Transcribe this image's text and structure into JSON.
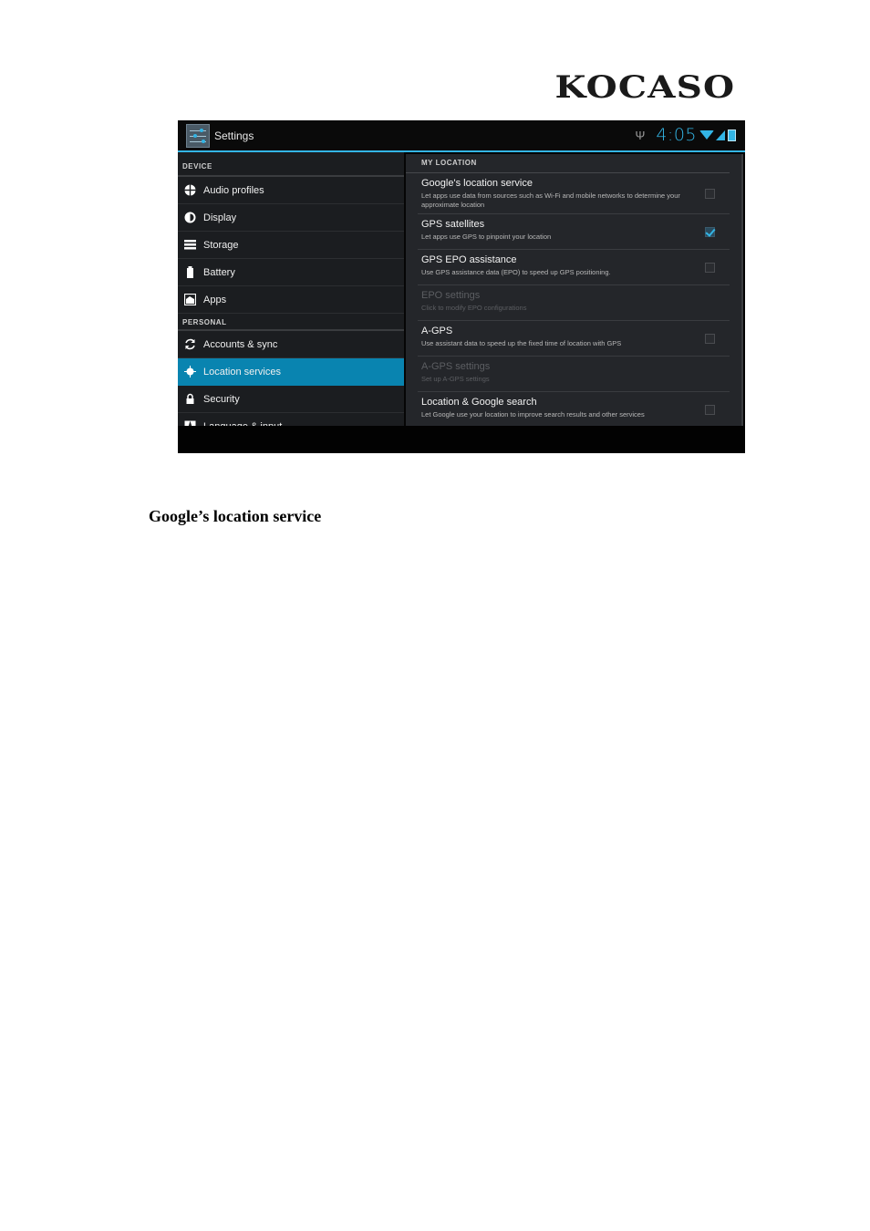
{
  "document": {
    "logo": "KOCASO",
    "caption": "Google’s location service"
  },
  "screenshot": {
    "action_bar": {
      "title": "Settings",
      "app_icon": "settings-sliders-icon"
    },
    "status_bar": {
      "usb_icon": "usb-icon",
      "time": "4:05",
      "wifi_icon": "wifi-icon",
      "signal_icon": "cell-signal-icon",
      "battery_icon": "battery-charging-icon",
      "accent_color": "#33b5e5"
    },
    "sidebar": {
      "sections": [
        {
          "header": "DEVICE",
          "items": [
            {
              "label": "Audio profiles",
              "icon": "audio-profiles-icon",
              "active": false
            },
            {
              "label": "Display",
              "icon": "display-brightness-icon",
              "active": false
            },
            {
              "label": "Storage",
              "icon": "storage-icon",
              "active": false
            },
            {
              "label": "Battery",
              "icon": "battery-icon",
              "active": false
            },
            {
              "label": "Apps",
              "icon": "apps-icon",
              "active": false
            }
          ]
        },
        {
          "header": "PERSONAL",
          "items": [
            {
              "label": "Accounts & sync",
              "icon": "sync-icon",
              "active": false
            },
            {
              "label": "Location services",
              "icon": "location-icon",
              "active": true
            },
            {
              "label": "Security",
              "icon": "lock-icon",
              "active": false
            },
            {
              "label": "Language & input",
              "icon": "language-icon",
              "active": false
            }
          ]
        }
      ],
      "active_color": "#0984b0"
    },
    "detail": {
      "header": "MY LOCATION",
      "prefs": [
        {
          "title": "Google's location service",
          "summary": "Let apps use data from sources such as Wi-Fi and mobile networks to determine your approximate location",
          "checkbox": true,
          "checked": false,
          "enabled": true
        },
        {
          "title": "GPS satellites",
          "summary": "Let apps use GPS to pinpoint your location",
          "checkbox": true,
          "checked": true,
          "enabled": true
        },
        {
          "title": "GPS EPO assistance",
          "summary": "Use GPS assistance data (EPO) to speed up GPS positioning.",
          "checkbox": true,
          "checked": false,
          "enabled": true
        },
        {
          "title": "EPO settings",
          "summary": "Click to modify EPO configurations",
          "checkbox": false,
          "checked": false,
          "enabled": false
        },
        {
          "title": "A-GPS",
          "summary": "Use assistant data to speed up the fixed time of location with GPS",
          "checkbox": true,
          "checked": false,
          "enabled": true
        },
        {
          "title": "A-GPS settings",
          "summary": "Set up A-GPS settings",
          "checkbox": false,
          "checked": false,
          "enabled": false
        },
        {
          "title": "Location & Google search",
          "summary": "Let Google use your location to improve search results and other services",
          "checkbox": true,
          "checked": false,
          "enabled": true
        }
      ]
    }
  }
}
